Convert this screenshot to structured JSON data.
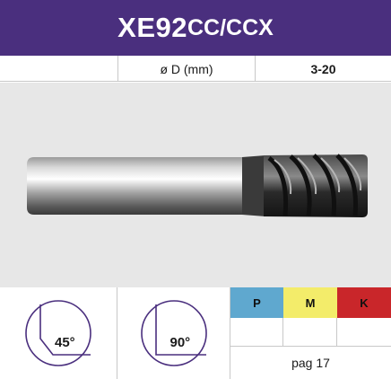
{
  "title": {
    "main": "XE92",
    "suffix": "CC/CCX"
  },
  "spec": {
    "label": "ø D (mm)",
    "value": "3-20"
  },
  "angles": [
    {
      "label": "45°"
    },
    {
      "label": "90°"
    }
  ],
  "materials": [
    {
      "code": "P",
      "color": "#5fa8cf"
    },
    {
      "code": "M",
      "color": "#f3ec6a"
    },
    {
      "code": "K",
      "color": "#c9262a"
    }
  ],
  "page_ref": "pag 17",
  "colors": {
    "header_bg": "#4a2f7e",
    "photo_bg": "#e7e7e7"
  }
}
